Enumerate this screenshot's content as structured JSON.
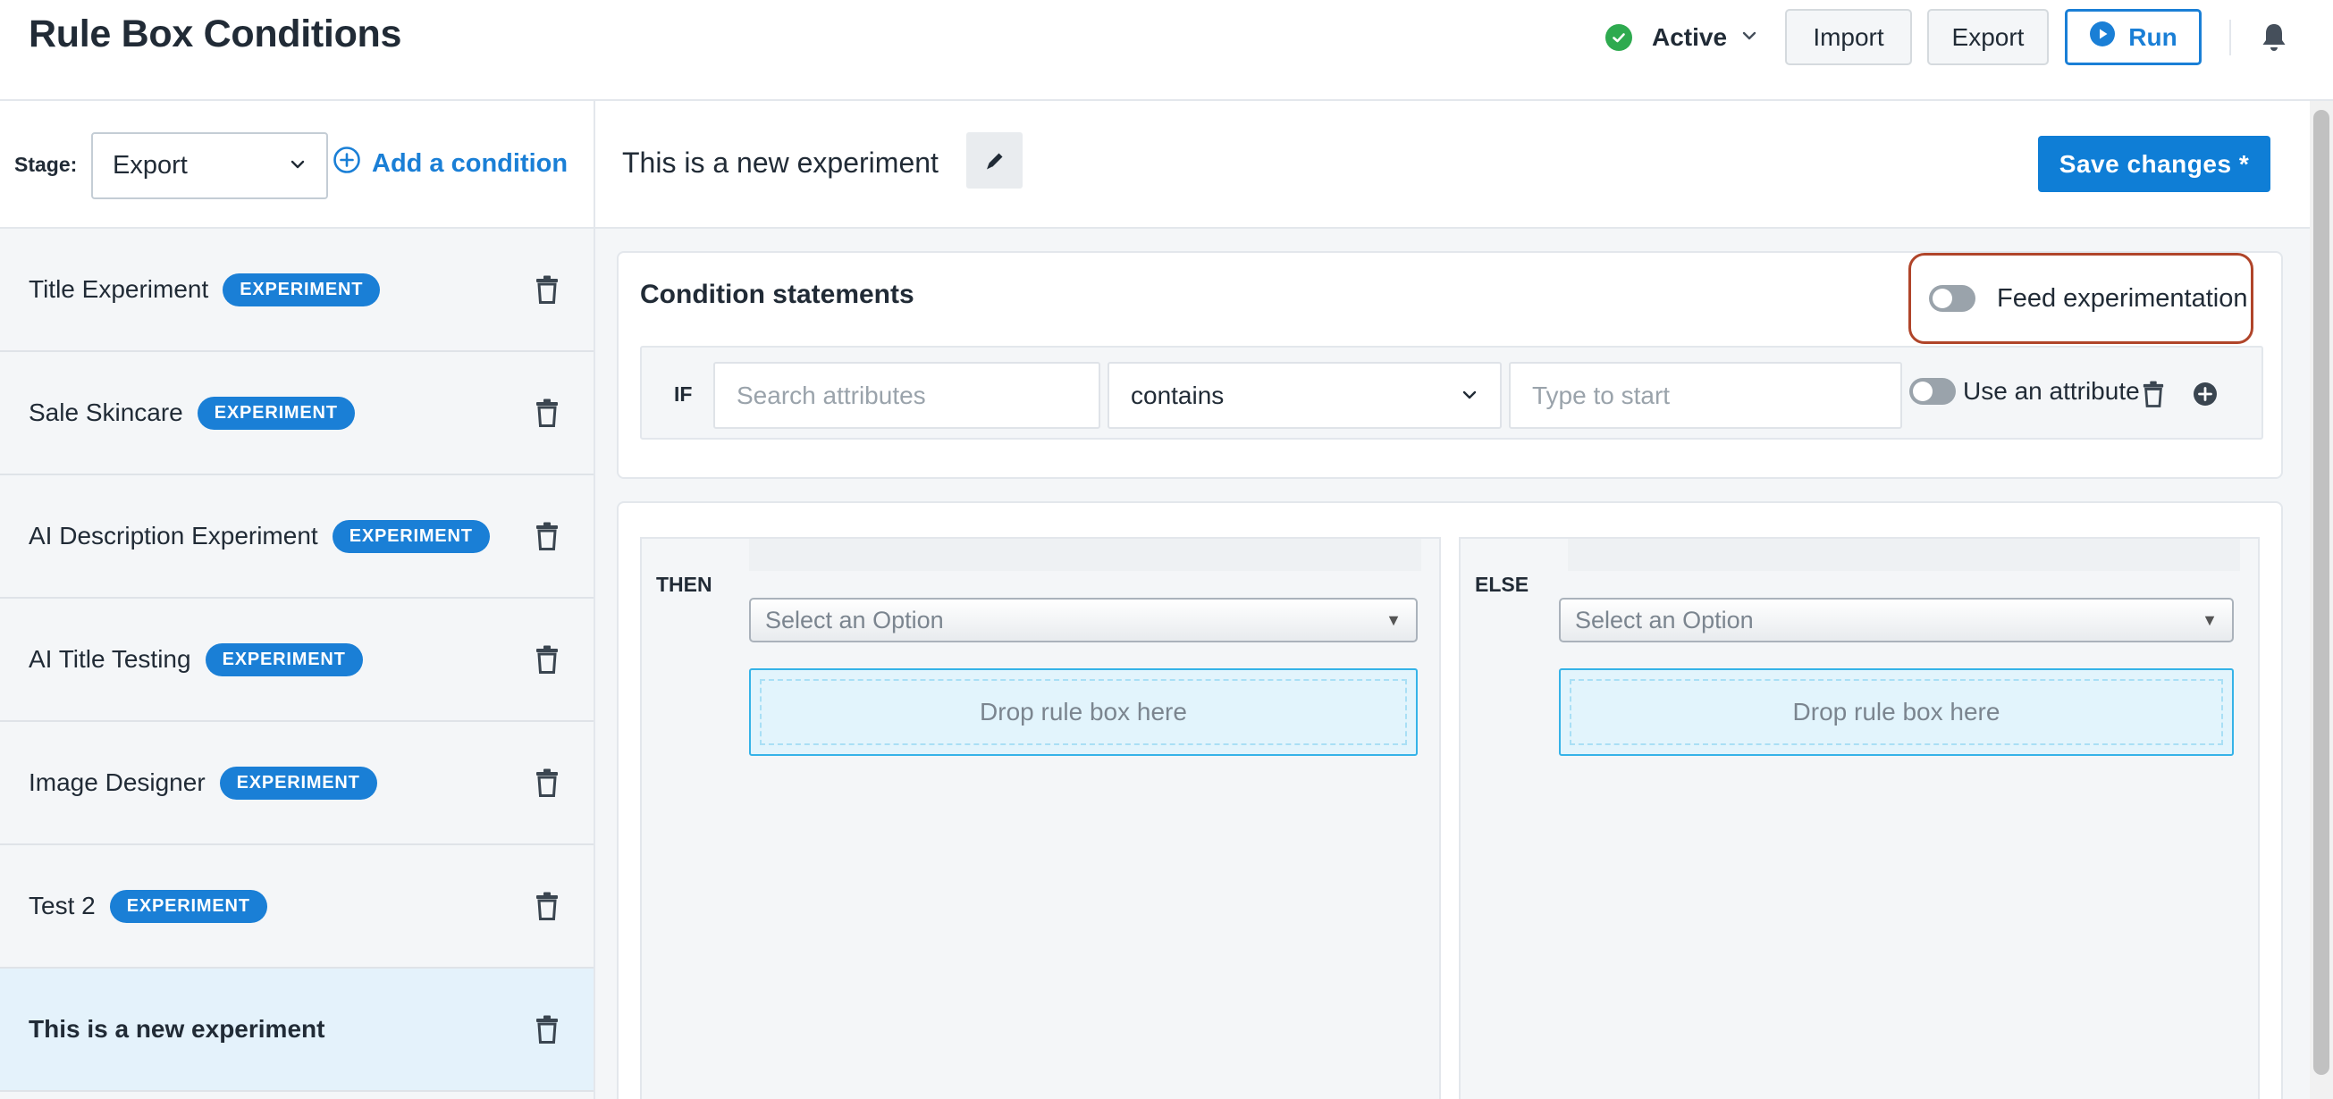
{
  "header": {
    "title": "Rule Box Conditions",
    "status": "Active",
    "import_label": "Import",
    "export_label": "Export",
    "run_label": "Run"
  },
  "sidebar": {
    "stage_label": "Stage:",
    "stage_value": "Export",
    "add_condition_label": "Add a condition",
    "items": [
      {
        "name": "Title Experiment",
        "badge": "EXPERIMENT"
      },
      {
        "name": "Sale Skincare",
        "badge": "EXPERIMENT"
      },
      {
        "name": "AI Description Experiment",
        "badge": "EXPERIMENT"
      },
      {
        "name": "AI Title Testing",
        "badge": "EXPERIMENT"
      },
      {
        "name": "Image Designer",
        "badge": "EXPERIMENT"
      },
      {
        "name": "Test 2",
        "badge": "EXPERIMENT"
      },
      {
        "name": "This is a new experiment",
        "selected": true
      }
    ]
  },
  "main": {
    "experiment_title": "This is a new experiment",
    "save_label": "Save changes *",
    "conditions": {
      "heading": "Condition statements",
      "feed_label": "Feed experimentation",
      "if_label": "IF",
      "search_placeholder": "Search attributes",
      "operator": "contains",
      "value_placeholder": "Type to start",
      "use_attribute_label": "Use an attribute"
    },
    "then": {
      "label": "THEN",
      "select_placeholder": "Select an Option",
      "drop_label": "Drop rule box here"
    },
    "else": {
      "label": "ELSE",
      "select_placeholder": "Select an Option",
      "drop_label": "Drop rule box here"
    }
  },
  "colors": {
    "accent": "#1a7fd6",
    "status_green": "#2eaa4f",
    "highlight_border": "#b0452a",
    "selected_row": "#e4f2fb"
  },
  "icons": [
    "check-circle-icon",
    "chevron-down-icon",
    "play-circle-icon",
    "bell-icon",
    "plus-circle-icon",
    "trash-icon",
    "pencil-icon"
  ]
}
